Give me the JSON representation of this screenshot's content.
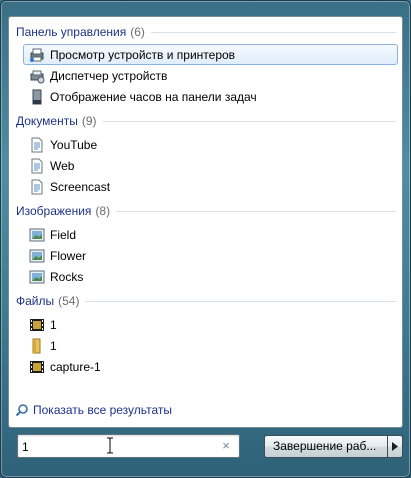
{
  "groups": [
    {
      "header": "Панель управления",
      "count": "(6)",
      "items": [
        {
          "label": "Просмотр устройств и принтеров",
          "icon": "printer-devices-icon"
        },
        {
          "label": "Диспетчер устройств",
          "icon": "device-manager-icon"
        },
        {
          "label": "Отображение часов на панели задач",
          "icon": "taskbar-clock-icon"
        }
      ]
    },
    {
      "header": "Документы",
      "count": "(9)",
      "items": [
        {
          "label": "YouTube",
          "icon": "document-icon"
        },
        {
          "label": "Web",
          "icon": "document-icon"
        },
        {
          "label": "Screencast",
          "icon": "document-icon"
        }
      ]
    },
    {
      "header": "Изображения",
      "count": "(8)",
      "items": [
        {
          "label": "Field",
          "icon": "image-icon"
        },
        {
          "label": "Flower",
          "icon": "image-icon"
        },
        {
          "label": "Rocks",
          "icon": "image-icon"
        }
      ]
    },
    {
      "header": "Файлы",
      "count": "(54)",
      "items": [
        {
          "label": "1",
          "icon": "video-file-icon"
        },
        {
          "label": "1",
          "icon": "folder-icon"
        },
        {
          "label": "capture-1",
          "icon": "video-file-icon"
        }
      ]
    }
  ],
  "show_all": "Показать все результаты",
  "search": {
    "value": "1",
    "clear_symbol": "×"
  },
  "shutdown": {
    "label": "Завершение раб..."
  },
  "colors": {
    "header_text": "#1e3287",
    "selection_border": "#8cb3e0",
    "background": "#3f7f96"
  }
}
